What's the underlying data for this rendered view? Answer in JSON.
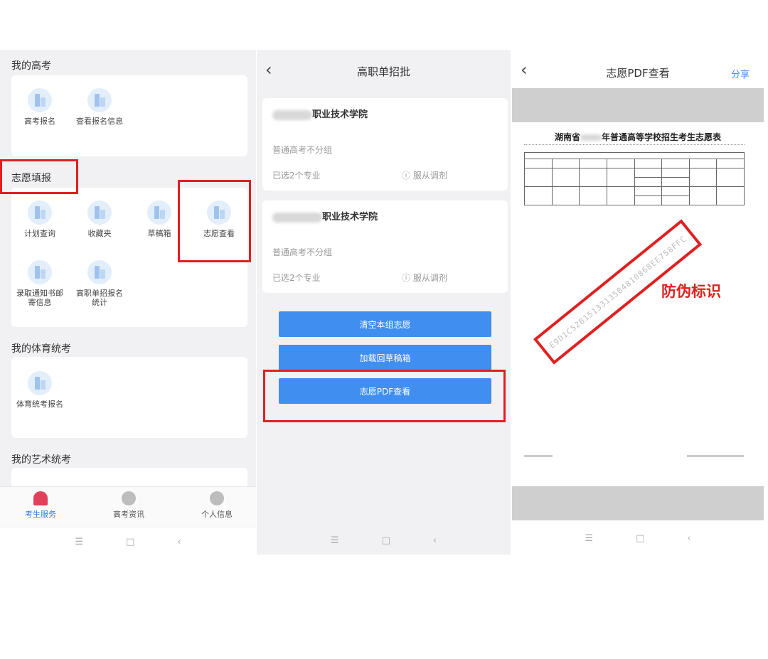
{
  "panel1": {
    "section_my_gaokao": "我的高考",
    "gaokao_items": [
      "高考报名",
      "查看报名信息"
    ],
    "section_zhiyuan": "志愿填报",
    "zhiyuan_items": [
      "计划查询",
      "收藏夹",
      "草稿箱",
      "志愿查看",
      "录取通知书邮寄信息",
      "高职单招报名统计"
    ],
    "section_sport": "我的体育统考",
    "sport_items": [
      "体育统考报名"
    ],
    "section_art": "我的艺术统考",
    "tabs": [
      "考生服务",
      "高考资讯",
      "个人信息"
    ]
  },
  "panel2": {
    "title": "高职单招批",
    "schools": [
      {
        "name_suffix": "职业技术学院",
        "group": "普通高考不分组",
        "selected": "已选2个专业",
        "adjust": "服从调剂"
      },
      {
        "name_suffix": "职业技术学院",
        "group": "普通高考不分组",
        "selected": "已选2个专业",
        "adjust": "服从调剂"
      }
    ],
    "buttons": [
      "清空本组志愿",
      "加载回草稿箱",
      "志愿PDF查看"
    ]
  },
  "panel3": {
    "title": "志愿PDF查看",
    "share": "分享",
    "doc_title_prefix": "湖南省",
    "doc_title_suffix": "年普通高等学校招生考生志愿表",
    "watermark_code": "E9D1C52B1513313504810868EE758FFC",
    "annotation": "防伪标识"
  },
  "colors": {
    "accent": "#3f8ef0",
    "highlight": "#e02020"
  }
}
